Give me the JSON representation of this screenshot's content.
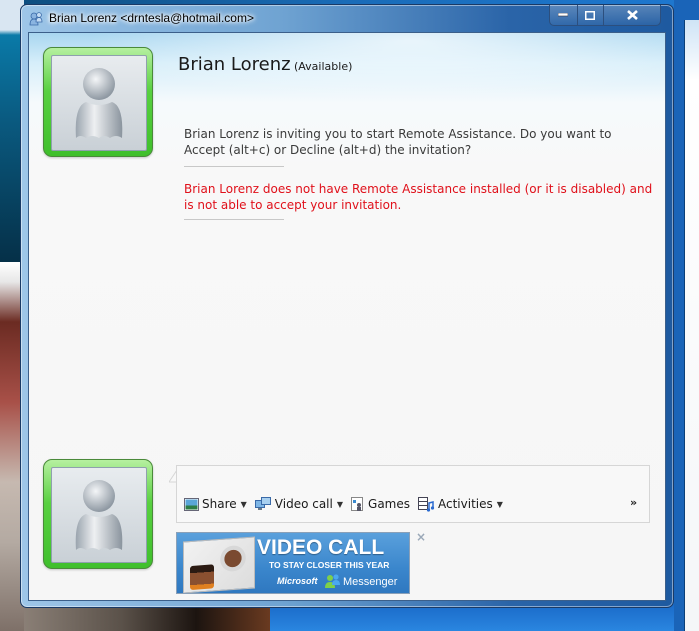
{
  "window": {
    "title": "Brian Lorenz <drntesla@hotmail.com>",
    "caption_buttons": {
      "minimize": "minimize",
      "maximize": "maximize",
      "close": "close"
    }
  },
  "contact": {
    "name": "Brian Lorenz",
    "status": "(Available)",
    "status_color": "#3fbf2c"
  },
  "conversation": {
    "messages": [
      {
        "type": "info",
        "text": "Brian Lorenz is inviting you to start Remote Assistance. Do you want to Accept (alt+c) or Decline (alt+d) the invitation?",
        "color": "#3a3a3a"
      },
      {
        "type": "error",
        "text": "Brian Lorenz does not have Remote Assistance installed (or it is disabled) and is not able to accept your invitation.",
        "color": "#e0101a"
      }
    ]
  },
  "compose": {
    "value": "",
    "toolbar": [
      {
        "label": "Share",
        "icon": "picture-icon",
        "dropdown": true
      },
      {
        "label": "Video call",
        "icon": "video-call-icon",
        "dropdown": true
      },
      {
        "label": "Games",
        "icon": "games-icon",
        "dropdown": false
      },
      {
        "label": "Activities",
        "icon": "activities-icon",
        "dropdown": true
      }
    ],
    "more_label": "»"
  },
  "ad": {
    "title": "VIDEO CALL",
    "subtitle": "TO STAY CLOSER THIS YEAR",
    "brand": "Microsoft",
    "product": "Messenger",
    "close_label": "×"
  }
}
